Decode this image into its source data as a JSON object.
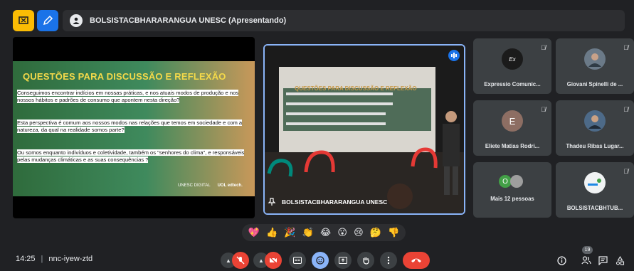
{
  "presentation_bar": {
    "title": "BOLSISTACBHARARANGUA UNESC (Apresentando)"
  },
  "slide": {
    "title": "QUESTÕES PARA DISCUSSÃO E REFLEXÃO",
    "paragraphs": [
      "Conseguimos encontrar indícios em nossas práticas, e nos atuais modos de produção e nos nossos hábitos e padrões de consumo que apontem nesta direção?",
      "Esta perspectiva é comum aos nossos modos nas relações que temos em sociedade e com a natureza, da qual na realidade somos parte?",
      "Ou somos enquanto indivíduos e coletividade, também os \"senhores do clima\", e responsáveis pelas mudanças climáticas e as suas consequências ?"
    ],
    "logo_left": "UNESC DIGITAL",
    "logo_right": "UOL edtech."
  },
  "camera": {
    "screen_title": "QUESTÕES PARA DISCUSSÃO E REFLEXÃO",
    "name": "BOLSISTACBHARARANGUA UNESC"
  },
  "participants": [
    {
      "name": "Expressio Comunic...",
      "initial": "",
      "avatar_color": "#1b1b1b"
    },
    {
      "name": "Giovani Spinelli de ...",
      "initial": "",
      "avatar_color": "#6b7a88"
    },
    {
      "name": "Eliete Matias Rodri...",
      "initial": "E",
      "avatar_color": "#8d6e63"
    },
    {
      "name": "Thadeu Ribas Lugar...",
      "initial": "",
      "avatar_color": "#4d6a88"
    },
    {
      "name": "Mais 12 pessoas",
      "initial": "O",
      "avatar_color": "#43a047"
    },
    {
      "name": "BOLSISTACBHTUB...",
      "initial": "",
      "avatar_color": "#f1f3f4"
    }
  ],
  "reactions": [
    "💖",
    "👍",
    "🎉",
    "👏",
    "😂",
    "😮",
    "😢",
    "🤔",
    "👎"
  ],
  "meeting": {
    "time": "14:25",
    "code": "nnc-iyew-ztd",
    "participant_count": "19"
  },
  "colors": {
    "accent": "#8ab4f8",
    "end_call": "#ea4335",
    "present_icon": "#fbbc04",
    "whiteboard_icon": "#1a73e8"
  }
}
